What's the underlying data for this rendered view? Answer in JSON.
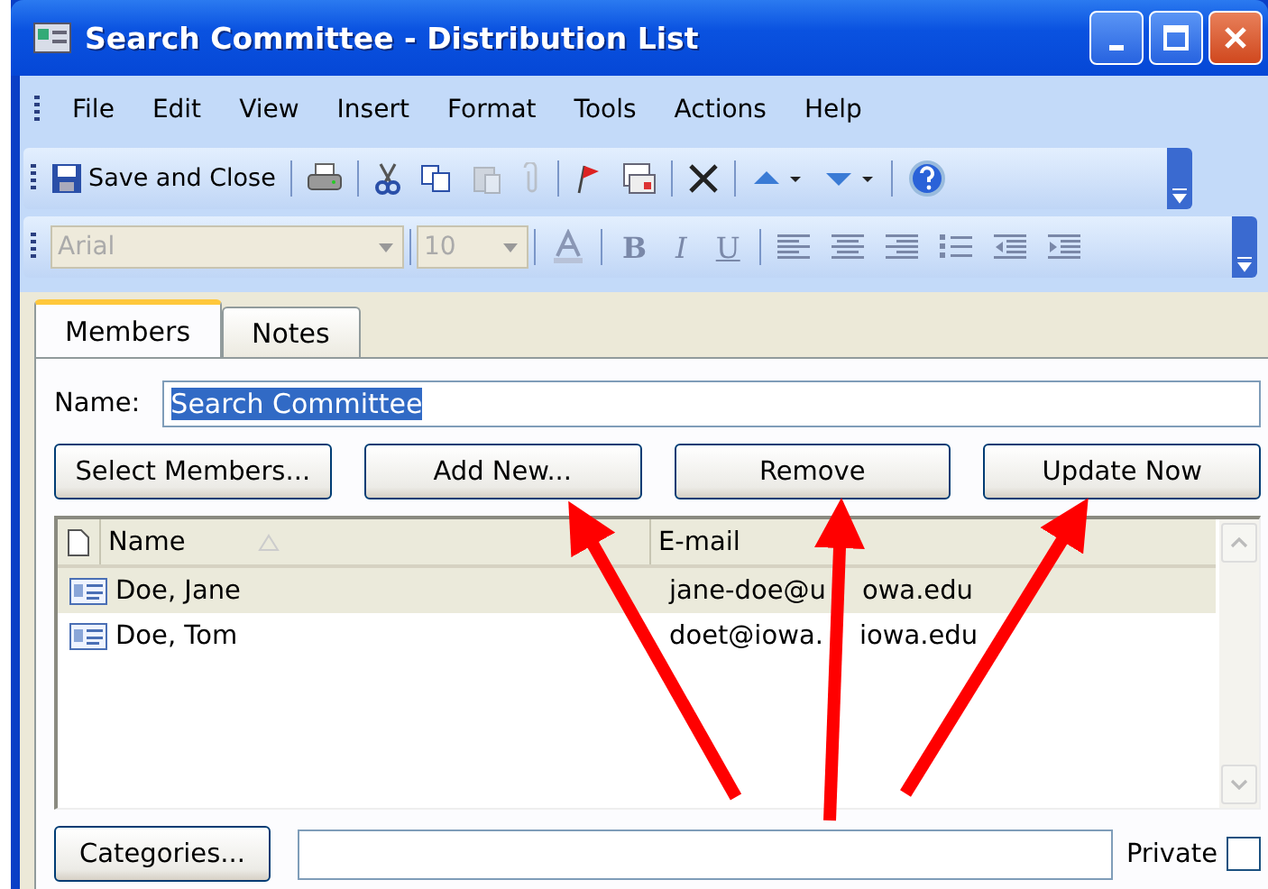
{
  "window": {
    "title": "Search Committee - Distribution List"
  },
  "menu": [
    "File",
    "Edit",
    "View",
    "Insert",
    "Format",
    "Tools",
    "Actions",
    "Help"
  ],
  "standard_toolbar": {
    "save_label": "Save and Close"
  },
  "format_toolbar": {
    "disabled": true,
    "font": "Arial",
    "size": "10",
    "bold": "B",
    "italic": "I",
    "underline": "U"
  },
  "tabs": [
    {
      "label": "Members",
      "selected": true
    },
    {
      "label": "Notes",
      "selected": false
    }
  ],
  "name_field": {
    "label": "Name:",
    "value": "Search Committee",
    "text_selected": true
  },
  "buttons": [
    "Select Members...",
    "Add New...",
    "Remove",
    "Update Now"
  ],
  "member_list": {
    "columns": [
      "Name",
      "E-mail"
    ],
    "rows": [
      {
        "name": "Doe, Jane",
        "email_parts": [
          "jane-doe@u",
          "owa.edu"
        ],
        "selected": true
      },
      {
        "name": "Doe, Tom",
        "email_parts": [
          "doet@iowa.",
          "iowa.edu"
        ],
        "selected": false
      }
    ]
  },
  "categories_button": "Categories...",
  "private": {
    "label": "Private",
    "checked": false
  }
}
